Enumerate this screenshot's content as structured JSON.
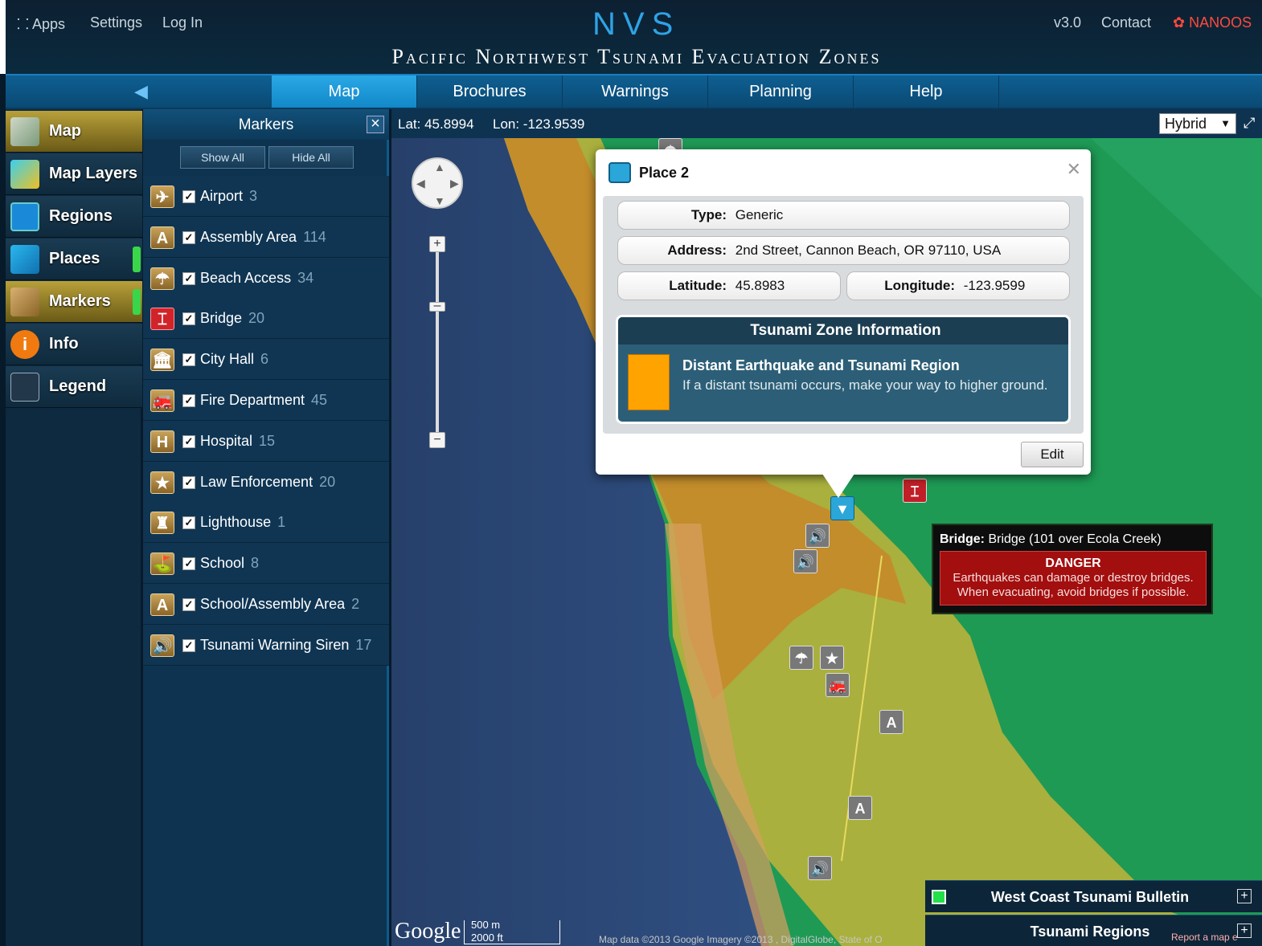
{
  "header": {
    "apps_label": "Apps",
    "settings_label": "Settings",
    "login_label": "Log In",
    "logo_text": "NVS",
    "title": "Pacific Northwest Tsunami Evacuation Zones",
    "version_label": "v3.0",
    "contact_label": "Contact",
    "nanoos_label": "NANOOS"
  },
  "nav": {
    "tabs": [
      {
        "label": "Map",
        "active": true
      },
      {
        "label": "Brochures",
        "active": false
      },
      {
        "label": "Warnings",
        "active": false
      },
      {
        "label": "Planning",
        "active": false
      },
      {
        "label": "Help",
        "active": false
      }
    ]
  },
  "sidebar": {
    "items": [
      {
        "label": "Map",
        "icon": "map-icon",
        "active": true
      },
      {
        "label": "Map Layers",
        "icon": "layers-icon",
        "active": false
      },
      {
        "label": "Regions",
        "icon": "regions-icon",
        "active": false
      },
      {
        "label": "Places",
        "icon": "places-icon",
        "active": false
      },
      {
        "label": "Markers",
        "icon": "markers-icon",
        "active": true
      },
      {
        "label": "Info",
        "icon": "info-icon",
        "active": false
      },
      {
        "label": "Legend",
        "icon": "legend-icon",
        "active": false
      }
    ]
  },
  "markers_panel": {
    "title": "Markers",
    "show_all": "Show All",
    "hide_all": "Hide All",
    "items": [
      {
        "label": "Airport",
        "count": "3",
        "icon": "airport-icon",
        "glyph": "✈"
      },
      {
        "label": "Assembly Area",
        "count": "114",
        "icon": "assembly-area-icon",
        "glyph": "A"
      },
      {
        "label": "Beach Access",
        "count": "34",
        "icon": "beach-access-icon",
        "glyph": "☂"
      },
      {
        "label": "Bridge",
        "count": "20",
        "icon": "bridge-icon",
        "glyph": "⌶"
      },
      {
        "label": "City Hall",
        "count": "6",
        "icon": "city-hall-icon",
        "glyph": "🏛"
      },
      {
        "label": "Fire Department",
        "count": "45",
        "icon": "fire-department-icon",
        "glyph": "🚒"
      },
      {
        "label": "Hospital",
        "count": "15",
        "icon": "hospital-icon",
        "glyph": "H"
      },
      {
        "label": "Law Enforcement",
        "count": "20",
        "icon": "law-enforcement-icon",
        "glyph": "★"
      },
      {
        "label": "Lighthouse",
        "count": "1",
        "icon": "lighthouse-icon",
        "glyph": "♜"
      },
      {
        "label": "School",
        "count": "8",
        "icon": "school-icon",
        "glyph": "⛳"
      },
      {
        "label": "School/Assembly Area",
        "count": "2",
        "icon": "school-assembly-area-icon",
        "glyph": "A"
      },
      {
        "label": "Tsunami Warning Siren",
        "count": "17",
        "icon": "tsunami-warning-siren-icon",
        "glyph": "🔊"
      }
    ]
  },
  "map": {
    "lat_label": "Lat: 45.8994",
    "lon_label": "Lon: -123.9539",
    "map_type": "Hybrid",
    "scale_top": "500 m",
    "scale_bottom": "2000 ft",
    "google_label": "Google",
    "attribution": "Map data ©2013 Google Imagery ©2013 , DigitalGlobe, State of O",
    "report_label": "Report a map e"
  },
  "popup": {
    "title": "Place 2",
    "type_label": "Type:",
    "type_value": "Generic",
    "address_label": "Address:",
    "address_value": "2nd Street, Cannon Beach, OR 97110, USA",
    "lat_label": "Latitude:",
    "lat_value": "45.8983",
    "lon_label": "Longitude:",
    "lon_value": "-123.9599",
    "zone_header": "Tsunami Zone Information",
    "zone_name": "Distant Earthquake and Tsunami Region",
    "zone_desc": "If a distant tsunami occurs, make your way to higher ground.",
    "edit_label": "Edit",
    "zone_color": "#ffa300"
  },
  "tooltip": {
    "title_label": "Bridge:",
    "title_value": "Bridge (101 over Ecola Creek)",
    "danger_title": "DANGER",
    "danger_text": "Earthquakes can damage or destroy bridges. When evacuating, avoid bridges if possible."
  },
  "panels": {
    "bulletin_label": "West Coast Tsunami Bulletin",
    "regions_label": "Tsunami Regions"
  },
  "colors": {
    "accent": "#1288c8",
    "sidebar_active": "#b8a03a",
    "danger": "#a30e0e",
    "zone_green": "#1e9a55",
    "zone_yellow": "#c2b43a",
    "zone_orange": "#c58a2a",
    "ocean": "#2a4a78"
  }
}
